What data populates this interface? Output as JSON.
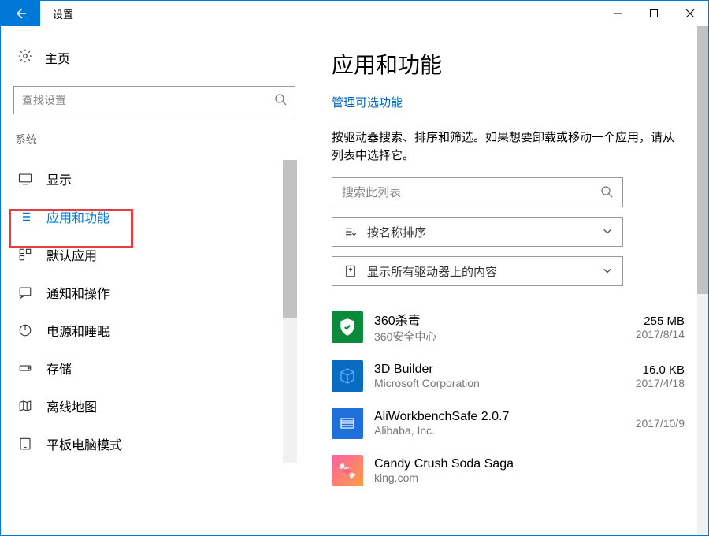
{
  "window": {
    "title": "设置"
  },
  "sidebar": {
    "home": "主页",
    "search_placeholder": "查找设置",
    "group": "系统",
    "items": [
      {
        "label": "显示"
      },
      {
        "label": "应用和功能"
      },
      {
        "label": "默认应用"
      },
      {
        "label": "通知和操作"
      },
      {
        "label": "电源和睡眠"
      },
      {
        "label": "存储"
      },
      {
        "label": "离线地图"
      },
      {
        "label": "平板电脑模式"
      }
    ]
  },
  "main": {
    "title": "应用和功能",
    "manage_link": "管理可选功能",
    "desc": "按驱动器搜索、排序和筛选。如果想要卸载或移动一个应用，请从列表中选择它。",
    "search_placeholder": "搜索此列表",
    "sort_label": "按名称排序",
    "filter_label": "显示所有驱动器上的内容",
    "apps": [
      {
        "name": "360杀毒",
        "publisher": "360安全中心",
        "size": "255 MB",
        "date": "2017/8/14",
        "iconClass": "icon-360"
      },
      {
        "name": "3D Builder",
        "publisher": "Microsoft Corporation",
        "size": "16.0 KB",
        "date": "2017/4/18",
        "iconClass": "icon-3db"
      },
      {
        "name": "AliWorkbenchSafe 2.0.7",
        "publisher": "Alibaba, Inc.",
        "size": "",
        "date": "2017/10/9",
        "iconClass": "icon-ali"
      },
      {
        "name": "Candy Crush Soda Saga",
        "publisher": "king.com",
        "size": "",
        "date": "",
        "iconClass": "icon-candy"
      }
    ]
  }
}
